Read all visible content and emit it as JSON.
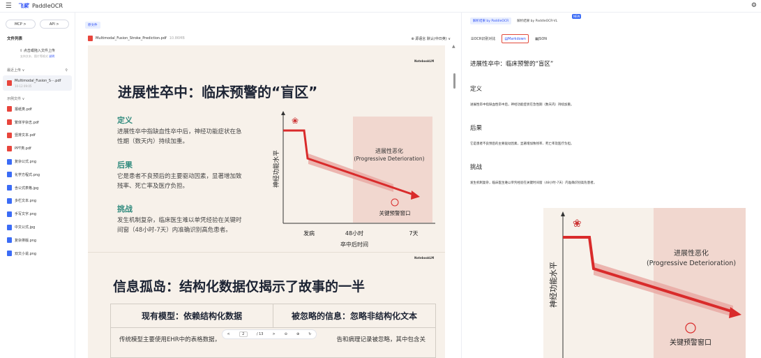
{
  "topbar": {
    "menu_icon": "hamburger-icon",
    "logo_text": "飞桨",
    "product": "PaddleOCR",
    "settings_icon": "gear-icon"
  },
  "sidebar": {
    "mcp": "MCP >",
    "api": "API >",
    "file_list": "文件列表",
    "upload_main": "点击或拖入文件上传",
    "upload_sub": "支持文本、图片等格式",
    "upload_link": "说明",
    "recent_label": "最近上传 ∨",
    "recent_name": "Multimodal_Fusion_S···.pdf",
    "recent_date": "10-12 09:05",
    "example_label": "示例文件 ∨",
    "examples": [
      {
        "name": "报纸类.pdf",
        "type": "pdf"
      },
      {
        "name": "繁体字杂志.pdf",
        "type": "pdf"
      },
      {
        "name": "竖排文本.pdf",
        "type": "pdf"
      },
      {
        "name": "PPT类.pdf",
        "type": "pdf"
      },
      {
        "name": "复杂公式.png",
        "type": "png"
      },
      {
        "name": "化学方程式.png",
        "type": "png"
      },
      {
        "name": "含公式表格.jpg",
        "type": "png"
      },
      {
        "name": "多栏文本.png",
        "type": "png"
      },
      {
        "name": "手写文字.png",
        "type": "png"
      },
      {
        "name": "中文公式.jpg",
        "type": "png"
      },
      {
        "name": "复杂排版.png",
        "type": "png"
      },
      {
        "name": "双文小说.png",
        "type": "png"
      }
    ]
  },
  "doc": {
    "tab": "原文件",
    "filename": "Multimodal_Fusion_Stroke_Prediction.pdf",
    "filesize": "10.86MB",
    "lang": "⊕ 源语言  默认(中日英) ∨",
    "brand": "NotebookLM",
    "slide1": {
      "title": "进展性卒中：临床预警的“盲区”",
      "definition_h": "定义",
      "definition_b": "进展性卒中指缺血性卒中后，神经功能症状在急性期（数天内）持续加重。",
      "consequence_h": "后果",
      "consequence_b": "它是患者不良预后的主要驱动因素，显著增加致残率、死亡率及医疗负担。",
      "challenge_h": "挑战",
      "challenge_b": "发生机制复杂，临床医生难以单凭经验在关键时间窗（48小时-7天）内准确识别高危患者。"
    },
    "chart": {
      "ylabel": "神经功能水平",
      "xlabel": "卒中后时间",
      "ticks": [
        "发病",
        "48小时",
        "7天"
      ],
      "zone_label1": "进展性恶化",
      "zone_label2": "(Progressive Deterioration)",
      "window_label": "关键预警窗口"
    },
    "slide2": {
      "title": "信息孤岛：结构化数据仅揭示了故事的一半",
      "col1": "现有模型：依赖结构化数据",
      "col2": "被忽略的信息：忽略非结构化文本",
      "row1": "传统模型主要使用EHR中的表格数据，",
      "row2": "告和病理记录被忽略，其中包含关"
    },
    "pager": {
      "prev": "<",
      "page": "2",
      "total": "/ 13",
      "next": ">",
      "zoom_out": "⊖",
      "zoom_in": "⊕",
      "rotate": "↻"
    }
  },
  "result": {
    "tab1": "解析结果 by PaddleOCR",
    "tab2": "解析结果 by PaddleOCR-VL",
    "new": "NEW",
    "view1": "OCR识别对比",
    "view2": "Markdown",
    "view3": "JSON",
    "md_title": "进展性卒中：临床预警的“盲区”",
    "sections": [
      {
        "h": "定义",
        "p": "进展性卒中指缺血性卒中后，神经功能症状在急性期（数天内）持续加重。"
      },
      {
        "h": "后果",
        "p": "它是患者不良预后的主要驱动因素，显著增加致残率、死亡率及医疗负担。"
      },
      {
        "h": "挑战",
        "p": "发生机制复杂，临床医生难以单凭经验在关键时间窗（48小时-7天）内准确识别高危患者。"
      }
    ]
  },
  "colors": {
    "accent": "#2d4ff5",
    "teal": "#2f8a7d",
    "arrow": "#d92b2b"
  }
}
